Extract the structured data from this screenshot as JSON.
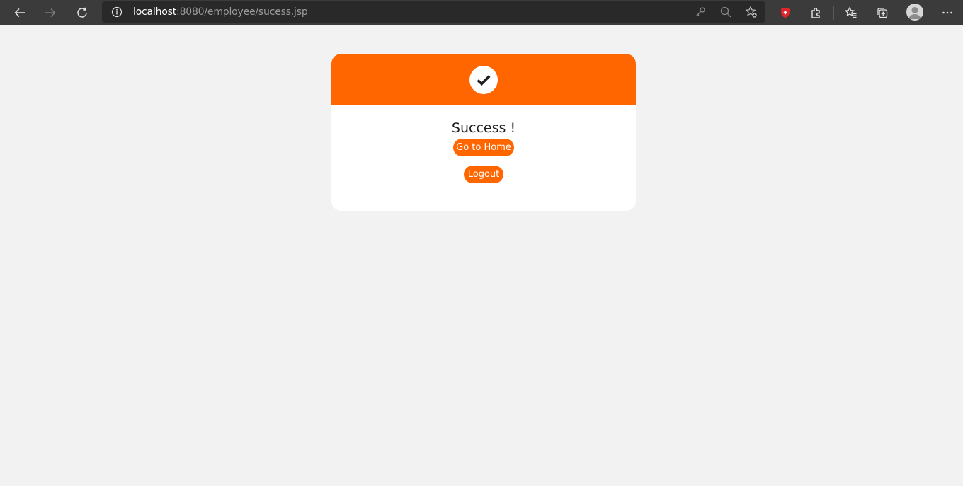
{
  "browser": {
    "url_host": "localhost",
    "url_rest": ":8080/employee/sucess.jsp",
    "icons": [
      "back-icon",
      "forward-icon",
      "refresh-icon",
      "site-info-icon",
      "key-icon",
      "zoom-out-icon",
      "add-favorite-icon",
      "shield-extension-icon",
      "extensions-icon",
      "favorites-icon",
      "collections-icon",
      "profile-icon",
      "more-icon"
    ]
  },
  "card": {
    "title": "Success !",
    "home_button": "Go to Home",
    "logout_button": "Logout",
    "accent_color": "#ff6600",
    "icon": "check-icon"
  }
}
